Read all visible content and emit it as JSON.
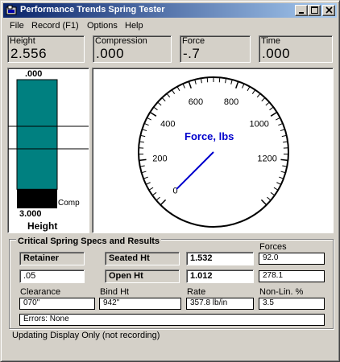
{
  "window": {
    "title": "Performance Trends Spring Tester"
  },
  "menu": {
    "file": "File",
    "record": "Record (F1)",
    "options": "Options",
    "help": "Help"
  },
  "readouts": {
    "height": {
      "label": "Height",
      "value": "2.556"
    },
    "compression": {
      "label": "Compression",
      "value": ".000"
    },
    "force": {
      "label": "Force",
      "value": "-.7"
    },
    "time": {
      "label": "Time",
      "value": ".000"
    }
  },
  "height_gauge": {
    "top_label": ".000",
    "bottom_label": "3.000",
    "comp_label": "Comp",
    "title": "Height",
    "level_fraction": 0.852,
    "bar_color": "#008080"
  },
  "force_gauge": {
    "title": "Force, lbs",
    "tick_labels": [
      "0",
      "200",
      "400",
      "600",
      "800",
      "1000",
      "1200"
    ],
    "max": 1400,
    "needle_value": -0.7,
    "needle_color": "#0000cc"
  },
  "specs": {
    "group_title": "Critical Spring Specs and Results",
    "retainer_label": "Retainer",
    "retainer_value": ".05",
    "seated_ht_label": "Seated Ht",
    "seated_ht_value": "1.532",
    "open_ht_label": "Open Ht",
    "open_ht_value": "1.012",
    "forces_label": "Forces",
    "force_seated": "92.0",
    "force_open": "278.1",
    "clearance_label": "Clearance",
    "clearance_value": "070\"",
    "bind_ht_label": "Bind Ht",
    "bind_ht_value": "942\"",
    "rate_label": "Rate",
    "rate_value": "357.8 lb/in",
    "nonlin_label": "Non-Lin. %",
    "nonlin_value": "3.5",
    "errors": "Errors: None"
  },
  "status": "Updating Display Only (not recording)"
}
